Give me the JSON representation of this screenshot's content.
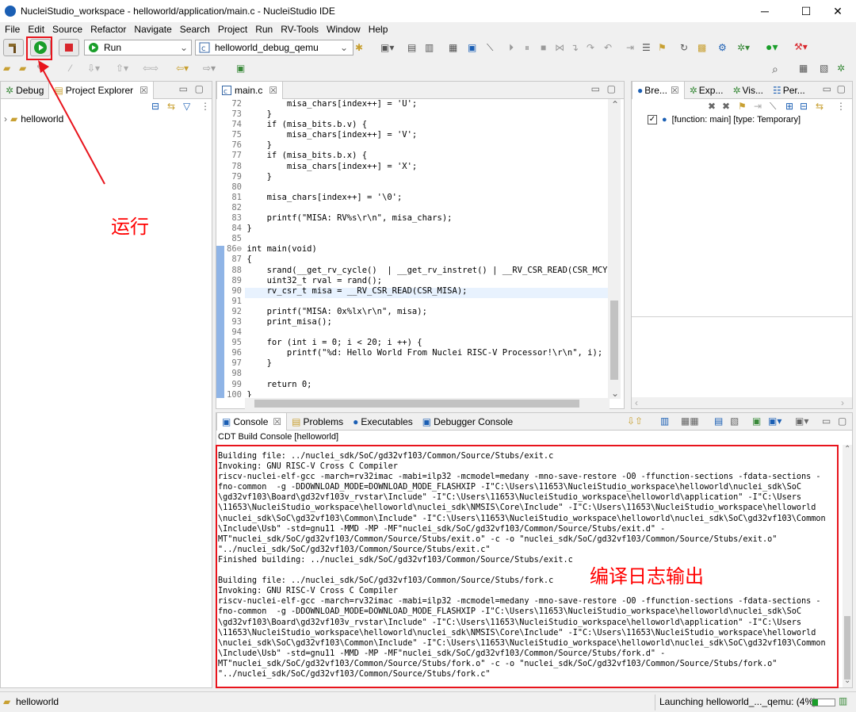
{
  "window": {
    "title": "NucleiStudio_workspace - helloworld/application/main.c - NucleiStudio IDE",
    "min_label": "─",
    "max_label": "☐",
    "close_label": "✕"
  },
  "menu": [
    "File",
    "Edit",
    "Source",
    "Refactor",
    "Navigate",
    "Search",
    "Project",
    "Run",
    "RV-Tools",
    "Window",
    "Help"
  ],
  "toolbar": {
    "mode_value": "Run",
    "launch_config_value": "helloworld_debug_qemu"
  },
  "left_panel": {
    "tabs": [
      "Debug",
      "Project Explorer"
    ],
    "tree_root": "helloworld"
  },
  "editor": {
    "tab_label": "main.c",
    "lines": [
      {
        "n": "72",
        "code": "        misa_chars[index++] = 'U';"
      },
      {
        "n": "73",
        "code": "    }"
      },
      {
        "n": "74",
        "code": "    if (misa_bits.b.v) {"
      },
      {
        "n": "75",
        "code": "        misa_chars[index++] = 'V';"
      },
      {
        "n": "76",
        "code": "    }"
      },
      {
        "n": "77",
        "code": "    if (misa_bits.b.x) {"
      },
      {
        "n": "78",
        "code": "        misa_chars[index++] = 'X';"
      },
      {
        "n": "79",
        "code": "    }"
      },
      {
        "n": "80",
        "code": ""
      },
      {
        "n": "81",
        "code": "    misa_chars[index++] = '\\0';"
      },
      {
        "n": "82",
        "code": ""
      },
      {
        "n": "83",
        "code": "    printf(\"MISA: RV%s\\r\\n\", misa_chars);"
      },
      {
        "n": "84",
        "code": "}"
      },
      {
        "n": "85",
        "code": ""
      },
      {
        "n": "86⊖",
        "code": "int main(void)"
      },
      {
        "n": "87",
        "code": "{"
      },
      {
        "n": "88",
        "code": "    srand(__get_rv_cycle()  | __get_rv_instret() | __RV_CSR_READ(CSR_MCYCL"
      },
      {
        "n": "89",
        "code": "    uint32_t rval = rand();"
      },
      {
        "n": "90",
        "code": "    rv_csr_t misa = __RV_CSR_READ(CSR_MISA);"
      },
      {
        "n": "91",
        "code": ""
      },
      {
        "n": "92",
        "code": "    printf(\"MISA: 0x%lx\\r\\n\", misa);"
      },
      {
        "n": "93",
        "code": "    print_misa();"
      },
      {
        "n": "94",
        "code": ""
      },
      {
        "n": "95",
        "code": "    for (int i = 0; i < 20; i ++) {"
      },
      {
        "n": "96",
        "code": "        printf(\"%d: Hello World From Nuclei RISC-V Processor!\\r\\n\", i);"
      },
      {
        "n": "97",
        "code": "    }"
      },
      {
        "n": "98",
        "code": ""
      },
      {
        "n": "99",
        "code": "    return 0;"
      },
      {
        "n": "100",
        "code": "}"
      }
    ]
  },
  "right_panel": {
    "tabs": [
      "Bre...",
      "Exp...",
      "Vis...",
      "Per..."
    ],
    "breakpoint": "[function: main] [type: Temporary]"
  },
  "console": {
    "tabs": [
      "Console",
      "Problems",
      "Executables",
      "Debugger Console"
    ],
    "subtitle": "CDT Build Console [helloworld]",
    "lines": [
      "Building file: ../nuclei_sdk/SoC/gd32vf103/Common/Source/Stubs/exit.c",
      "Invoking: GNU RISC-V Cross C Compiler",
      "riscv-nuclei-elf-gcc -march=rv32imac -mabi=ilp32 -mcmodel=medany -mno-save-restore -O0 -ffunction-sections -fdata-sections -",
      "fno-common  -g -DDOWNLOAD_MODE=DOWNLOAD_MODE_FLASHXIP -I\"C:\\Users\\11653\\NucleiStudio_workspace\\helloworld\\nuclei_sdk\\SoC",
      "\\gd32vf103\\Board\\gd32vf103v_rvstar\\Include\" -I\"C:\\Users\\11653\\NucleiStudio_workspace\\helloworld\\application\" -I\"C:\\Users",
      "\\11653\\NucleiStudio_workspace\\helloworld\\nuclei_sdk\\NMSIS\\Core\\Include\" -I\"C:\\Users\\11653\\NucleiStudio_workspace\\helloworld",
      "\\nuclei_sdk\\SoC\\gd32vf103\\Common\\Include\" -I\"C:\\Users\\11653\\NucleiStudio_workspace\\helloworld\\nuclei_sdk\\SoC\\gd32vf103\\Common",
      "\\Include\\Usb\" -std=gnu11 -MMD -MP -MF\"nuclei_sdk/SoC/gd32vf103/Common/Source/Stubs/exit.d\" -",
      "MT\"nuclei_sdk/SoC/gd32vf103/Common/Source/Stubs/exit.o\" -c -o \"nuclei_sdk/SoC/gd32vf103/Common/Source/Stubs/exit.o\"",
      "\"../nuclei_sdk/SoC/gd32vf103/Common/Source/Stubs/exit.c\"",
      "Finished building: ../nuclei_sdk/SoC/gd32vf103/Common/Source/Stubs/exit.c",
      "",
      "Building file: ../nuclei_sdk/SoC/gd32vf103/Common/Source/Stubs/fork.c",
      "Invoking: GNU RISC-V Cross C Compiler",
      "riscv-nuclei-elf-gcc -march=rv32imac -mabi=ilp32 -mcmodel=medany -mno-save-restore -O0 -ffunction-sections -fdata-sections -",
      "fno-common  -g -DDOWNLOAD_MODE=DOWNLOAD_MODE_FLASHXIP -I\"C:\\Users\\11653\\NucleiStudio_workspace\\helloworld\\nuclei_sdk\\SoC",
      "\\gd32vf103\\Board\\gd32vf103v_rvstar\\Include\" -I\"C:\\Users\\11653\\NucleiStudio_workspace\\helloworld\\application\" -I\"C:\\Users",
      "\\11653\\NucleiStudio_workspace\\helloworld\\nuclei_sdk\\NMSIS\\Core\\Include\" -I\"C:\\Users\\11653\\NucleiStudio_workspace\\helloworld",
      "\\nuclei_sdk\\SoC\\gd32vf103\\Common\\Include\" -I\"C:\\Users\\11653\\NucleiStudio_workspace\\helloworld\\nuclei_sdk\\SoC\\gd32vf103\\Common",
      "\\Include\\Usb\" -std=gnu11 -MMD -MP -MF\"nuclei_sdk/SoC/gd32vf103/Common/Source/Stubs/fork.d\" -",
      "MT\"nuclei_sdk/SoC/gd32vf103/Common/Source/Stubs/fork.o\" -c -o \"nuclei_sdk/SoC/gd32vf103/Common/Source/Stubs/fork.o\"",
      "\"../nuclei_sdk/SoC/gd32vf103/Common/Source/Stubs/fork.c\""
    ]
  },
  "annotations": {
    "run_label": "运行",
    "log_label": "编译日志输出"
  },
  "status": {
    "project": "helloworld",
    "launch": "Launching helloworld_..._qemu: (4%)",
    "progress": 0.04
  },
  "colors": {
    "accent_red": "#e8141c",
    "run_green": "#1a9e2a",
    "stop_red": "#d8262c"
  }
}
